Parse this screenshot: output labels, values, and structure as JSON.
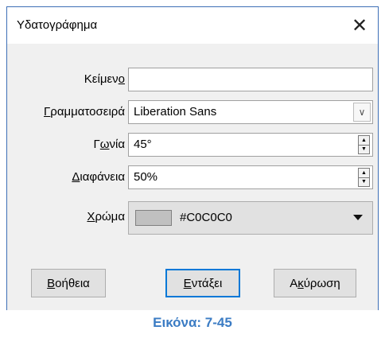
{
  "dialog": {
    "title": "Υδατογράφημα",
    "close_symbol": "✕"
  },
  "fields": {
    "text": {
      "label_pre": "Κείμεν",
      "label_acc": "ο",
      "label_post": "",
      "value": ""
    },
    "font": {
      "label_pre": "",
      "label_acc": "Γ",
      "label_post": "ραμματοσειρά",
      "value": "Liberation Sans"
    },
    "angle": {
      "label_pre": "Γ",
      "label_acc": "ω",
      "label_post": "νία",
      "value": "45°"
    },
    "transparency": {
      "label_pre": "",
      "label_acc": "Δ",
      "label_post": "ιαφάνεια",
      "value": "50%"
    },
    "color": {
      "label_pre": "",
      "label_acc": "Χ",
      "label_post": "ρώμα",
      "value": "#C0C0C0",
      "swatch_hex": "#c0c0c0"
    }
  },
  "buttons": {
    "help": {
      "acc": "Β",
      "rest": "οήθεια"
    },
    "ok": {
      "acc": "Ε",
      "rest": "ντάξει"
    },
    "cancel": {
      "pre": "Α",
      "acc": "κ",
      "rest": "ύρωση"
    }
  },
  "caption": "Εικόνα: 7-45",
  "colors": {
    "accent": "#0078d7",
    "caption": "#3b7cc4",
    "border": "#3d6fb6"
  }
}
